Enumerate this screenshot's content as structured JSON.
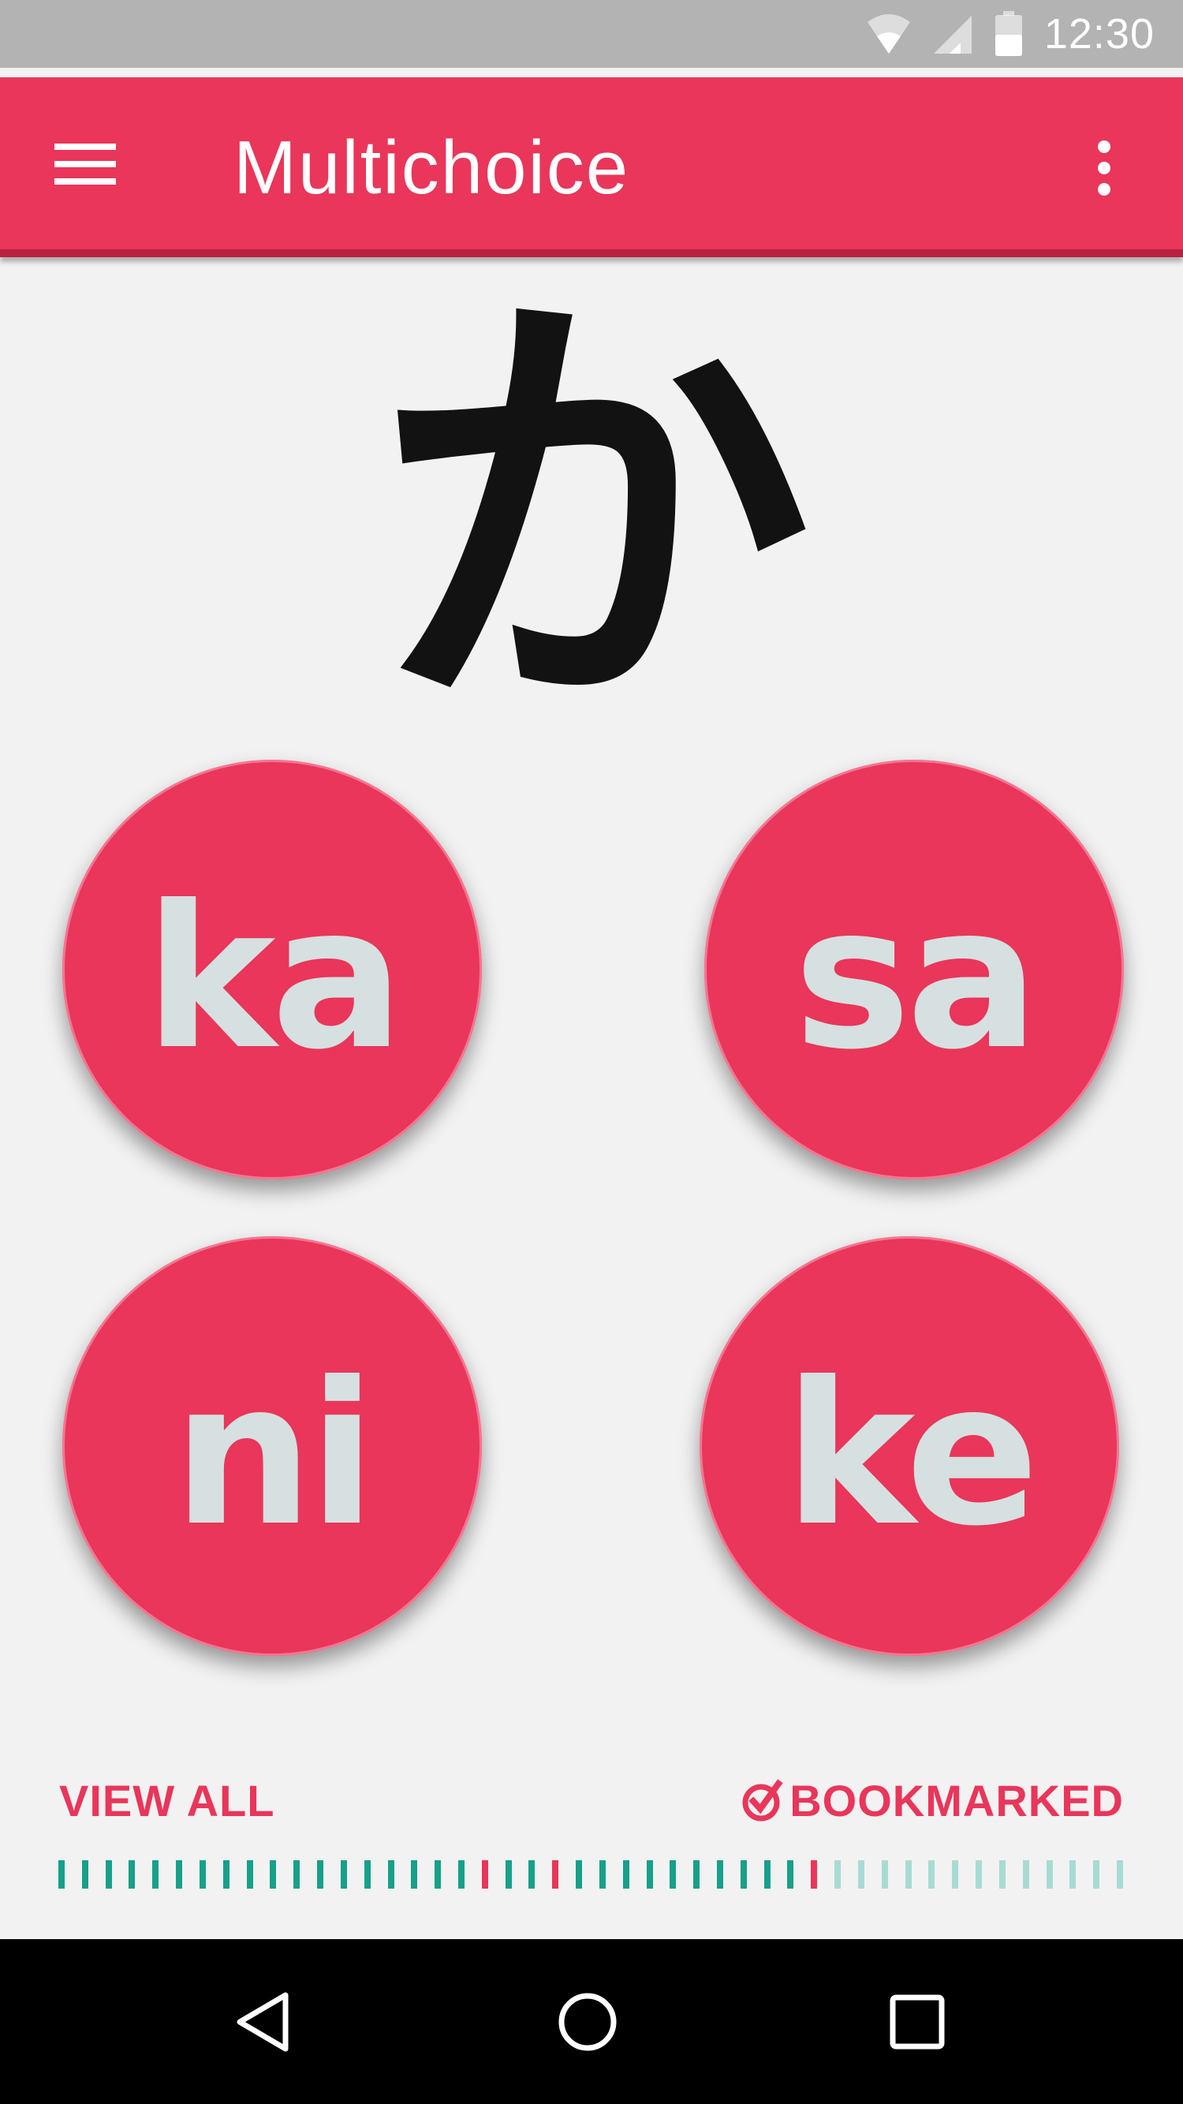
{
  "status_bar": {
    "time": "12:30",
    "icons": [
      "wifi-icon",
      "cell-signal-icon",
      "battery-icon"
    ]
  },
  "app_bar": {
    "title": "Multichoice",
    "menu_icon": "hamburger-menu-icon",
    "overflow_icon": "more-vert-icon"
  },
  "question": {
    "kana": "か"
  },
  "choices": [
    {
      "label": "ka"
    },
    {
      "label": "sa"
    },
    {
      "label": "ni"
    },
    {
      "label": "ke"
    }
  ],
  "footer": {
    "view_all": "VIEW ALL",
    "bookmarked": "BOOKMARKED",
    "bookmark_icon": "check-badge-icon"
  },
  "progress": {
    "total": 46,
    "states": [
      "done",
      "done",
      "done",
      "done",
      "done",
      "done",
      "done",
      "done",
      "done",
      "done",
      "done",
      "done",
      "done",
      "done",
      "done",
      "done",
      "done",
      "done",
      "wrong",
      "done",
      "done",
      "wrong",
      "done",
      "done",
      "done",
      "done",
      "done",
      "done",
      "done",
      "done",
      "done",
      "done",
      "wrong",
      "pending",
      "pending",
      "pending",
      "pending",
      "pending",
      "pending",
      "pending",
      "pending",
      "pending",
      "pending",
      "pending",
      "pending",
      "pending"
    ],
    "colors": {
      "done": "#17a08a",
      "wrong": "#e9365a",
      "pending": "#a8dbd3",
      "pending_wrong": "#f5b3c1"
    }
  },
  "theme": {
    "primary": "#e9365a",
    "primary_dark": "#b8213f",
    "choice_text": "#d6e0e0",
    "background": "#f2f2f2"
  },
  "nav_bar": {
    "icons": [
      "back-triangle-icon",
      "home-circle-icon",
      "recents-square-icon"
    ]
  }
}
